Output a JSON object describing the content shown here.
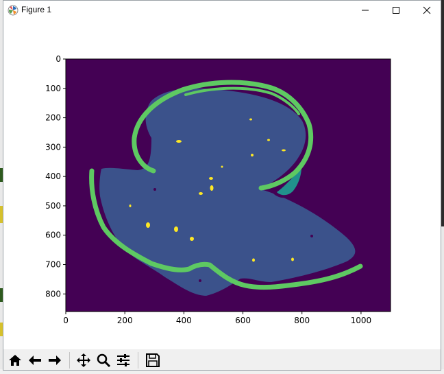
{
  "window": {
    "title": "Figure 1",
    "icon": "matplotlib-icon",
    "controls": [
      "minimize-icon",
      "maximize-icon",
      "close-icon"
    ]
  },
  "toolbar": {
    "buttons": [
      "home-icon",
      "back-arrow-icon",
      "forward-arrow-icon",
      "pan-icon",
      "zoom-icon",
      "configure-subplots-icon",
      "save-icon"
    ]
  },
  "chart_data": {
    "type": "heatmap",
    "description_colormap": "viridis",
    "xlim": [
      0,
      1100
    ],
    "ylim": [
      860,
      0
    ],
    "x_ticks": [
      "0",
      "200",
      "400",
      "600",
      "800",
      "1000"
    ],
    "y_ticks": [
      "0",
      "100",
      "200",
      "300",
      "400",
      "500",
      "600",
      "700",
      "800"
    ],
    "class_colors": {
      "background": "#440154",
      "body": "#3b528b",
      "notch": "#21918c",
      "rim": "#5ec962",
      "spots": "#fde725"
    }
  },
  "background_text": {
    "bottom_left": "..."
  }
}
